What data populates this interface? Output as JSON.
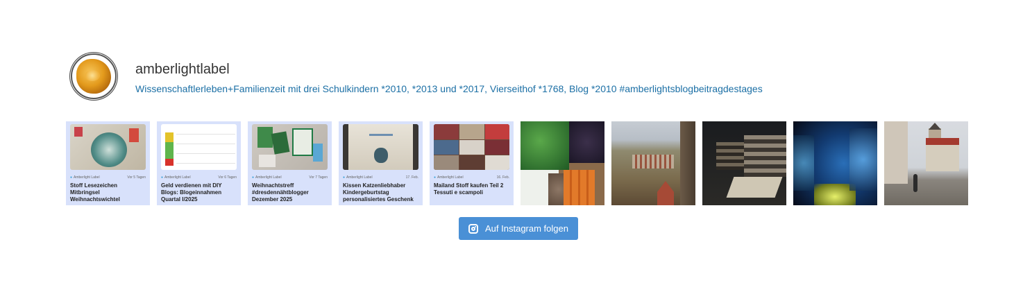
{
  "profile": {
    "username": "amberlightlabel",
    "bio": "Wissenschaftlerleben+Familienzeit mit drei Schulkindern *2010, *2013 und *2017, Vierseithof *1768, Blog *2010 #amberlightsblogbeitragdestages"
  },
  "posts": [
    {
      "kind": "card",
      "author": "Amberlight Label",
      "time": "Vor 5 Tagen",
      "title": "Stoff Lesezeichen Mitbringsel Weihnachtswichtel"
    },
    {
      "kind": "card",
      "author": "Amberlight Label",
      "time": "Vor 6 Tagen",
      "title": "Geld verdienen mit DIY Blogs: Blogeinnahmen Quartal I/2025"
    },
    {
      "kind": "card",
      "author": "Amberlight Label",
      "time": "Vor 7 Tagen",
      "title": "Weihnachtstreff #dresdennähtblogger Dezember 2025"
    },
    {
      "kind": "card",
      "author": "Amberlight Label",
      "time": "17. Feb.",
      "title": "Kissen Katzenliebhaber Kindergeburtstag personalisiertes Geschenk"
    },
    {
      "kind": "card",
      "author": "Amberlight Label",
      "time": "16. Feb.",
      "title": "Mailand Stoff kaufen Teil 2 Tessuti e scampoli"
    },
    {
      "kind": "photo",
      "subject": "vegetables"
    },
    {
      "kind": "photo",
      "subject": "village-landscape"
    },
    {
      "kind": "photo",
      "subject": "museum-interior"
    },
    {
      "kind": "photo",
      "subject": "illuminated-cave"
    },
    {
      "kind": "photo",
      "subject": "castle-courtyard"
    }
  ],
  "follow_button": {
    "label": "Auf Instagram folgen",
    "icon": "instagram-icon"
  }
}
